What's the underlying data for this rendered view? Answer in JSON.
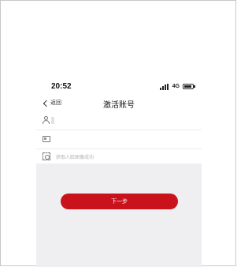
{
  "status_bar": {
    "time": "20:52",
    "network": "4G",
    "icons": [
      "signal-icon",
      "battery-icon"
    ]
  },
  "nav": {
    "back_label": "返回",
    "title": "激活账号"
  },
  "form": {
    "face_status": "获取人脸图像成功",
    "icons": [
      "user-icon",
      "id-card-icon",
      "face-scan-icon"
    ]
  },
  "actions": {
    "next_label": "下一步"
  },
  "colors": {
    "primary": "#c9121c",
    "background": "#efeff1"
  }
}
